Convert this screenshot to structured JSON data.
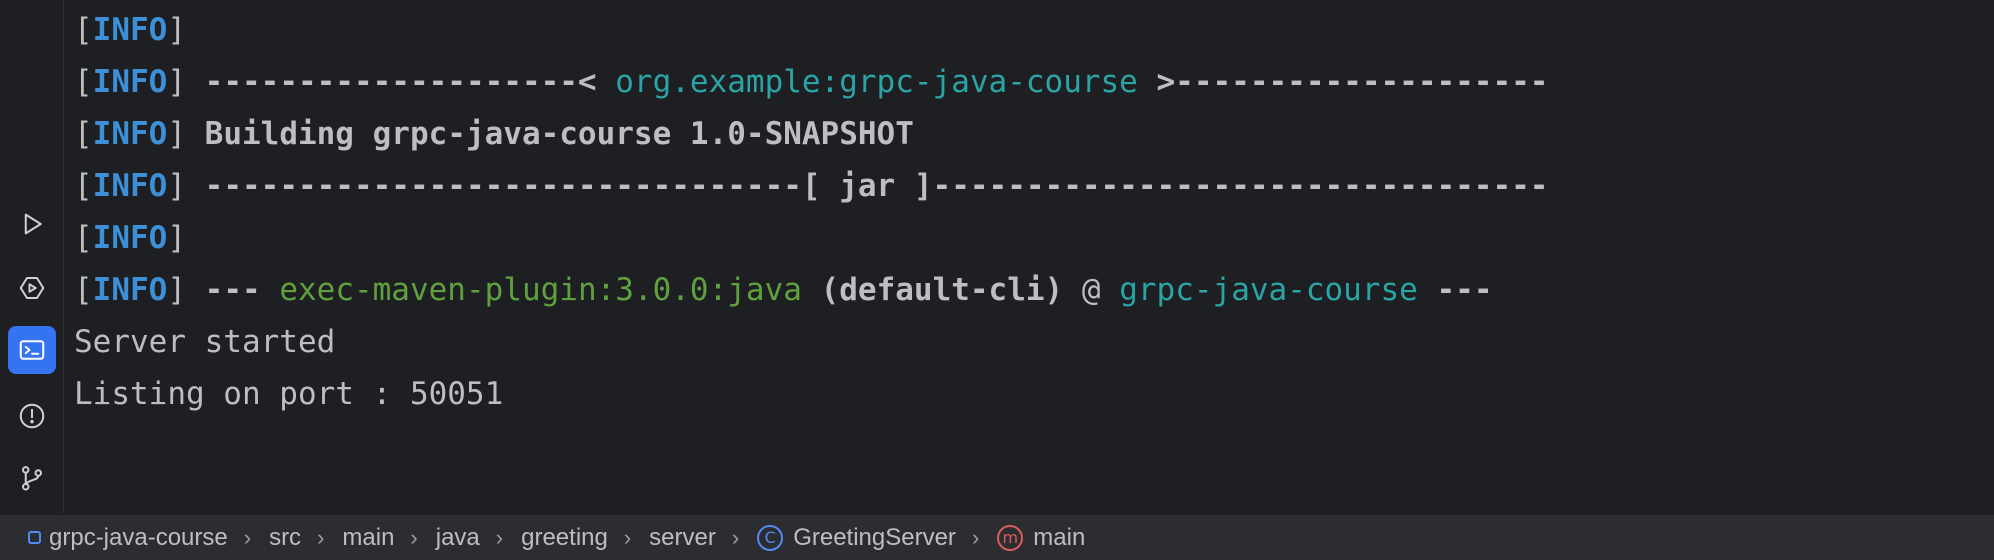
{
  "sidebar": {
    "icons": [
      {
        "name": "run-icon"
      },
      {
        "name": "services-icon"
      },
      {
        "name": "terminal-icon",
        "active": true
      },
      {
        "name": "problems-icon"
      },
      {
        "name": "git-icon"
      }
    ]
  },
  "terminal": {
    "bracket_open": "[",
    "bracket_close": "]",
    "info": "INFO",
    "lines": [
      {
        "type": "info_empty"
      },
      {
        "type": "project_header",
        "left": " --------------------< ",
        "artifact": "org.example:grpc-java-course",
        "right": " >--------------------"
      },
      {
        "type": "building",
        "text": " Building grpc-java-course 1.0-SNAPSHOT"
      },
      {
        "type": "packaging",
        "text": " --------------------------------[ jar ]---------------------------------"
      },
      {
        "type": "info_empty"
      },
      {
        "type": "plugin",
        "prefix": " --- ",
        "plugin": "exec-maven-plugin:3.0.0:java",
        "goal": " (default-cli)",
        "at": " @ ",
        "project": "grpc-java-course",
        "suffix": " ---"
      },
      {
        "type": "plain",
        "text": "Server started"
      },
      {
        "type": "plain",
        "text": "Listing on port : 50051"
      }
    ]
  },
  "status_bar": {
    "breadcrumbs": [
      {
        "label": "grpc-java-course",
        "icon": "module-icon"
      },
      {
        "label": "src"
      },
      {
        "label": "main"
      },
      {
        "label": "java"
      },
      {
        "label": "greeting"
      },
      {
        "label": "server"
      },
      {
        "label": "GreetingServer",
        "icon": "class-icon",
        "icon_glyph": "C",
        "icon_color": "#548af7"
      },
      {
        "label": "main",
        "icon": "method-icon",
        "icon_glyph": "m",
        "icon_color": "#db5c5c"
      }
    ],
    "separator": "›"
  }
}
